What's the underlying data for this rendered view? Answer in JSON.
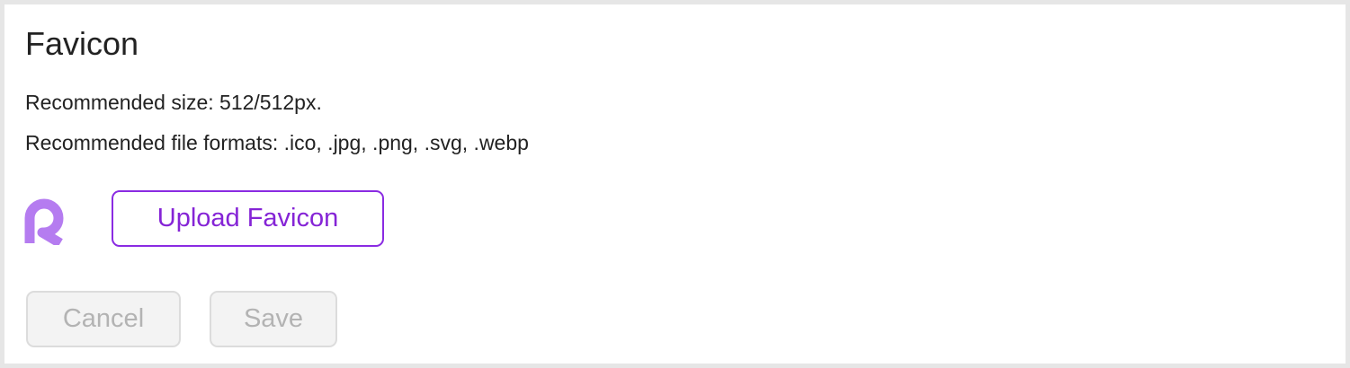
{
  "section": {
    "title": "Favicon",
    "recommended_size": "Recommended size: 512/512px.",
    "recommended_formats": "Recommended file formats: .ico, .jpg, .png, .svg, .webp"
  },
  "favicon": {
    "icon": "R-logo-icon",
    "color": "#b57cf0"
  },
  "buttons": {
    "upload_label": "Upload Favicon",
    "cancel_label": "Cancel",
    "save_label": "Save"
  },
  "colors": {
    "accent": "#8a2be2",
    "disabled_text": "#b3b3b3",
    "disabled_bg": "#f3f3f3"
  }
}
